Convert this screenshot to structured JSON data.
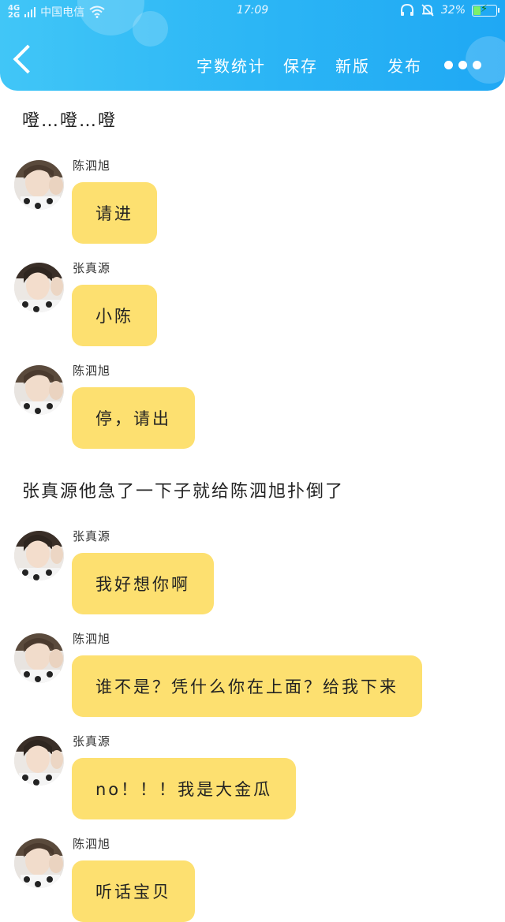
{
  "status_bar": {
    "network": [
      "4G",
      "2G"
    ],
    "carrier": "中国电信",
    "time": "17:09",
    "battery": "32%",
    "battery_level": 0.32
  },
  "toolbar": {
    "word_count": "字数统计",
    "save": "保存",
    "new_version": "新版",
    "publish": "发布"
  },
  "story": [
    {
      "type": "narration",
      "text": "噔…噔…噔"
    },
    {
      "type": "message",
      "speaker": "陈泗旭",
      "text": "请进"
    },
    {
      "type": "message",
      "speaker": "张真源",
      "text": "小陈"
    },
    {
      "type": "message",
      "speaker": "陈泗旭",
      "text": "停，请出"
    },
    {
      "type": "narration",
      "text": "张真源他急了一下子就给陈泗旭扑倒了"
    },
    {
      "type": "message",
      "speaker": "张真源",
      "text": "我好想你啊"
    },
    {
      "type": "message",
      "speaker": "陈泗旭",
      "text": "谁不是？凭什么你在上面？给我下来"
    },
    {
      "type": "message",
      "speaker": "张真源",
      "text": "no！！！我是大金瓜"
    },
    {
      "type": "message",
      "speaker": "陈泗旭",
      "text": "听话宝贝"
    }
  ]
}
